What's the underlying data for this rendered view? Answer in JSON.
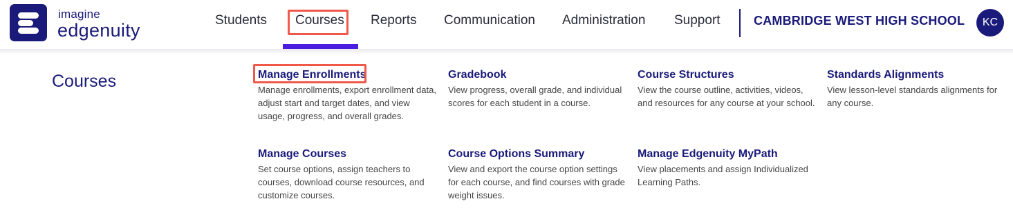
{
  "brand": {
    "top": "imagine",
    "main": "edgenuity",
    "logo_icon": "edgenuity-logo-icon",
    "color": "#1a1a7a"
  },
  "nav": {
    "items": [
      {
        "label": "Students"
      },
      {
        "label": "Courses",
        "active": true
      },
      {
        "label": "Reports"
      },
      {
        "label": "Communication"
      },
      {
        "label": "Administration"
      },
      {
        "label": "Support"
      }
    ],
    "active_color": "#4b1de0"
  },
  "school": {
    "name": "CAMBRIDGE WEST HIGH SCHOOL"
  },
  "user": {
    "initials": "KC"
  },
  "highlight_color": "#f0584a",
  "menu": {
    "title": "Courses",
    "items": [
      {
        "label": "Manage Enrollments",
        "description": "Manage enrollments, export enrollment data, adjust start and target dates, and view usage, progress, and overall grades."
      },
      {
        "label": "Gradebook",
        "description": "View progress, overall grade, and individual scores for each student in a course."
      },
      {
        "label": "Course Structures",
        "description": "View the course outline, activities, videos, and resources for any course at your school."
      },
      {
        "label": "Standards Alignments",
        "description": "View lesson-level standards alignments for any course."
      },
      {
        "label": "Manage Courses",
        "description": "Set course options, assign teachers to courses, download course resources, and customize courses."
      },
      {
        "label": "Course Options Summary",
        "description": "View and export the course option settings for each course, and find courses with grade weight issues."
      },
      {
        "label": "Manage Edgenuity MyPath",
        "description": "View placements and assign Individualized Learning Paths."
      }
    ]
  }
}
